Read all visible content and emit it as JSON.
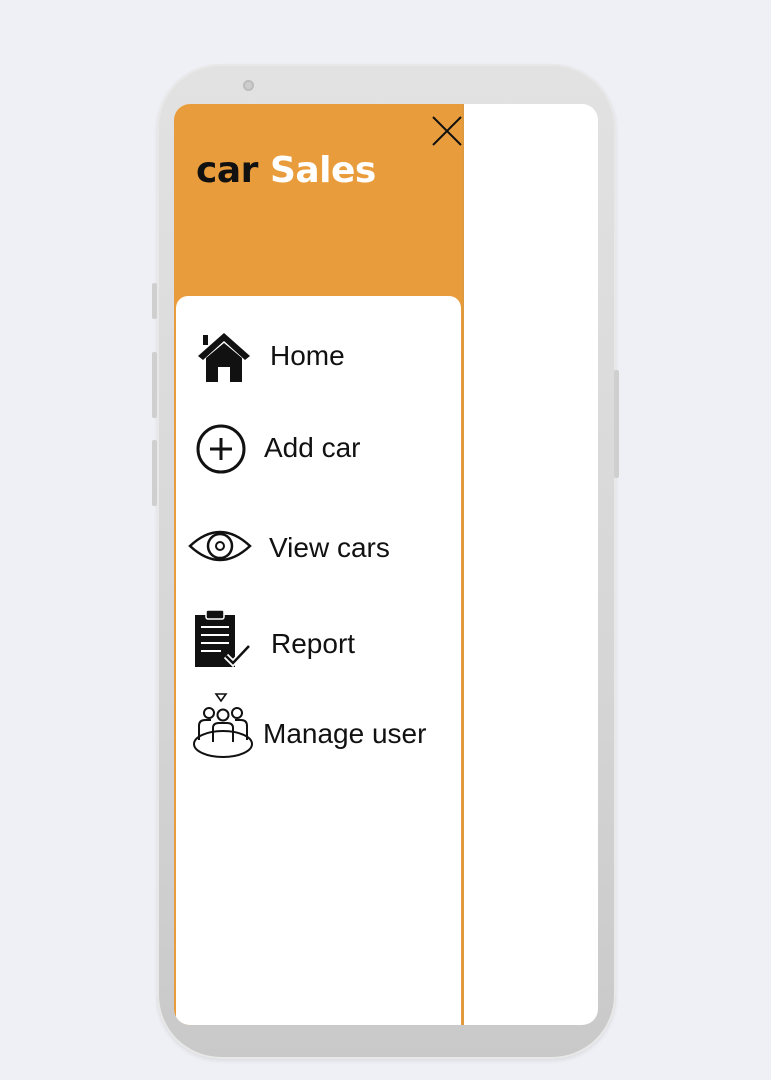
{
  "app": {
    "brand_part1": "car",
    "brand_part2": "Sales"
  },
  "menu": {
    "items": [
      {
        "label": "Home",
        "icon": "home-icon"
      },
      {
        "label": "Add car",
        "icon": "add-circle-icon"
      },
      {
        "label": "View cars",
        "icon": "eye-icon"
      },
      {
        "label": "Report",
        "icon": "clipboard-report-icon"
      },
      {
        "label": "Manage user",
        "icon": "user-group-icon"
      }
    ]
  },
  "colors": {
    "drawer_header": "#e99c3b",
    "page_background": "#eff0f5",
    "text": "#111111"
  }
}
